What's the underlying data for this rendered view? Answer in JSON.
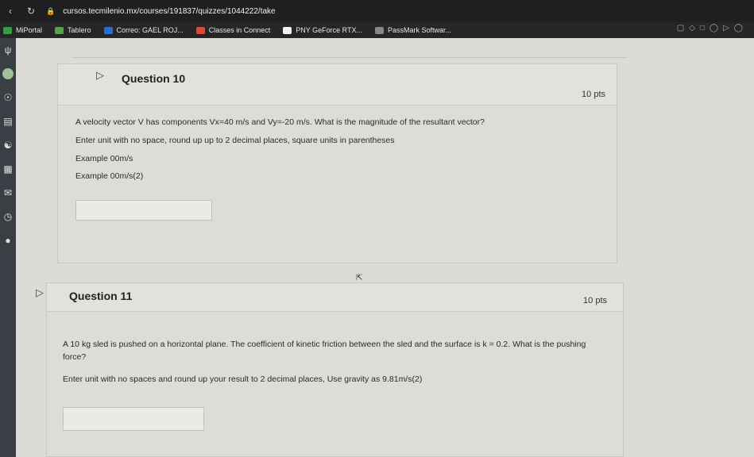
{
  "browser": {
    "url": "cursos.tecmilenio.mx/courses/191837/quizzes/1044222/take",
    "bookmarks": [
      {
        "label": "MiPortal",
        "color": "#3a9b4a"
      },
      {
        "label": "Tablero",
        "color": "#5aa04d"
      },
      {
        "label": "Correo: GAEL ROJ...",
        "color": "#2a6fd0"
      },
      {
        "label": "Classes in Connect",
        "color": "#d84a36"
      },
      {
        "label": "PNY GeForce RTX...",
        "color": "#f2f2f2"
      },
      {
        "label": "PassMark Softwar...",
        "color": "#888888"
      }
    ]
  },
  "questions": [
    {
      "title": "Question 10",
      "points": "10 pts",
      "lines": [
        "A velocity vector V has components Vx=40 m/s and Vy=-20 m/s. What is the magnitude of the resultant vector?",
        "Enter unit with no space, round up up to 2 decimal places, square units in parentheses",
        "Example 00m/s",
        "Example 00m/s(2)"
      ],
      "answer": ""
    },
    {
      "title": "Question 11",
      "points": "10 pts",
      "lines": [
        "A 10 kg sled is pushed on a horizontal plane. The coefficient of kinetic friction between the sled and the surface is k = 0.2. What is the pushing force?",
        "Enter unit with no spaces and round up your result to 2 decimal places, Use gravity as 9.81m/s(2)"
      ],
      "answer": ""
    }
  ]
}
